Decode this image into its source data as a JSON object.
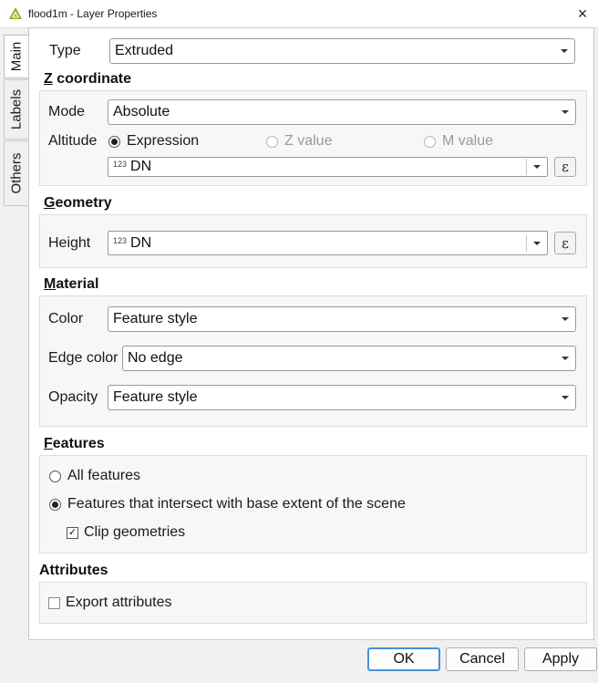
{
  "window": {
    "title": "flood1m - Layer Properties",
    "close_icon": "×"
  },
  "tabs": [
    {
      "label": "Main"
    },
    {
      "label": "Labels"
    },
    {
      "label": "Others"
    }
  ],
  "type_row": {
    "label": "Type",
    "value": "Extruded"
  },
  "z_coordinate": {
    "title_ul": "Z",
    "title_rest": " coordinate",
    "mode_label": "Mode",
    "mode_value": "Absolute",
    "altitude_label": "Altitude",
    "options": {
      "expression": "Expression",
      "z_value": "Z value",
      "m_value": "M value"
    },
    "selected": "expression",
    "expression_field": {
      "badge": "123",
      "value": "DN"
    },
    "expression_button": "ε"
  },
  "geometry": {
    "title_ul": "G",
    "title_rest": "eometry",
    "height_label": "Height",
    "height_field": {
      "badge": "123",
      "value": "DN"
    },
    "expression_button": "ε"
  },
  "material": {
    "title_ul": "M",
    "title_rest": "aterial",
    "color_label": "Color",
    "color_value": "Feature style",
    "edge_label": "Edge color",
    "edge_value": "No edge",
    "opacity_label": "Opacity",
    "opacity_value": "Feature style"
  },
  "features": {
    "title_ul": "F",
    "title_rest": "eatures",
    "all_label": "All features",
    "intersect_label": "Features that intersect with base extent of the scene",
    "selected": "intersect",
    "clip_label": "Clip geometries",
    "clip_checked": true,
    "check_mark": "✓"
  },
  "attributes": {
    "title": "Attributes",
    "export_label": "Export attributes",
    "export_checked": false
  },
  "buttons": {
    "ok": "OK",
    "cancel": "Cancel",
    "apply": "Apply"
  },
  "colors": {
    "accent": "#4a90d9",
    "app_icon": "#8ab31f"
  }
}
